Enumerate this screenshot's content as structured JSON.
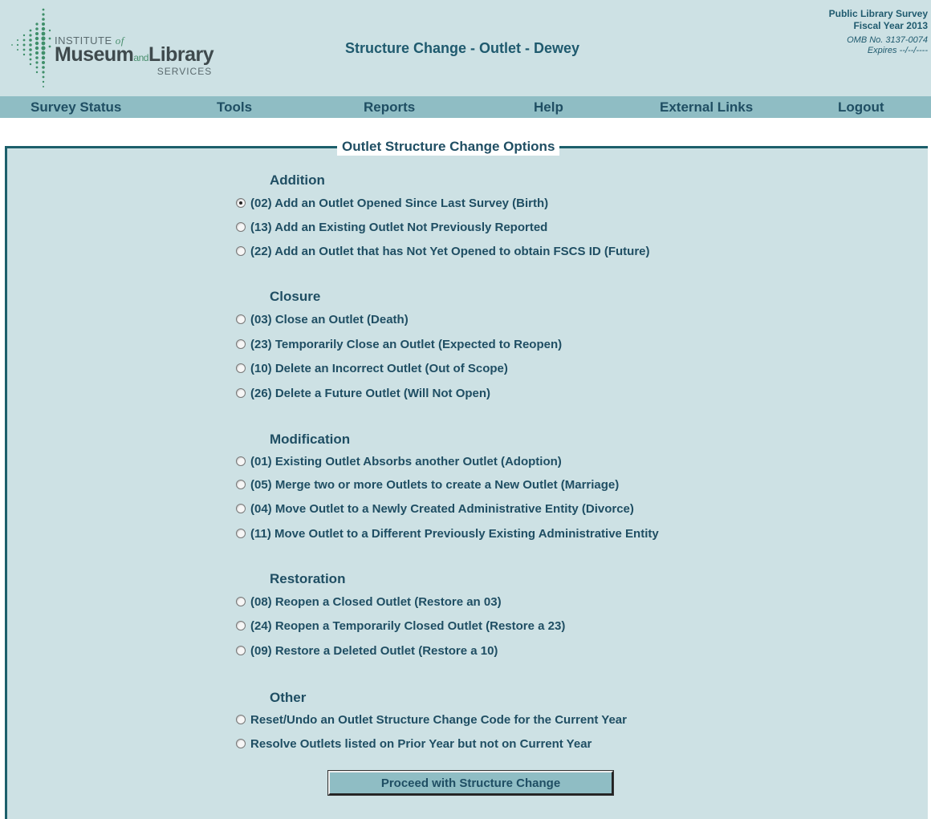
{
  "header": {
    "logo": {
      "institute": "INSTITUTE",
      "of": "of",
      "museum": "Museum",
      "and": "and",
      "library": "Library",
      "services": "SERVICES"
    },
    "page_title": "Structure Change - Outlet - Dewey",
    "survey_line1": "Public Library Survey",
    "survey_line2": "Fiscal Year 2013",
    "omb": "OMB No. 3137-0074",
    "expires": "Expires --/--/----"
  },
  "nav": {
    "items": [
      "Survey Status",
      "Tools",
      "Reports",
      "Help",
      "External Links",
      "Logout"
    ]
  },
  "panel": {
    "legend": "Outlet Structure Change Options",
    "groups": [
      {
        "heading": "Addition",
        "options": [
          {
            "label": "(02) Add an Outlet Opened Since Last Survey (Birth)",
            "checked": true
          },
          {
            "label": "(13) Add an Existing Outlet Not Previously Reported",
            "checked": false
          },
          {
            "label": "(22) Add an Outlet that has Not Yet Opened to obtain FSCS ID (Future)",
            "checked": false
          }
        ]
      },
      {
        "heading": "Closure",
        "options": [
          {
            "label": "(03) Close an Outlet (Death)",
            "checked": false
          },
          {
            "label": "(23) Temporarily Close an Outlet (Expected to Reopen)",
            "checked": false
          },
          {
            "label": "(10) Delete an Incorrect Outlet (Out of Scope)",
            "checked": false
          },
          {
            "label": "(26) Delete a Future Outlet (Will Not Open)",
            "checked": false
          }
        ]
      },
      {
        "heading": "Modification",
        "options": [
          {
            "label": "(01) Existing Outlet Absorbs another Outlet (Adoption)",
            "checked": false
          },
          {
            "label": "(05) Merge two or more Outlets to create a New Outlet (Marriage)",
            "checked": false
          },
          {
            "label": "(04) Move Outlet to a Newly Created Administrative Entity (Divorce)",
            "checked": false
          },
          {
            "label": "(11) Move Outlet to a Different Previously Existing Administrative Entity",
            "checked": false
          }
        ]
      },
      {
        "heading": "Restoration",
        "options": [
          {
            "label": "(08) Reopen a Closed Outlet (Restore an 03)",
            "checked": false
          },
          {
            "label": "(24) Reopen a Temporarily Closed Outlet (Restore a 23)",
            "checked": false
          },
          {
            "label": "(09) Restore a Deleted Outlet (Restore a 10)",
            "checked": false
          }
        ]
      },
      {
        "heading": "Other",
        "options": [
          {
            "label": "Reset/Undo an Outlet Structure Change Code for the Current Year",
            "checked": false
          },
          {
            "label": "Resolve Outlets listed on Prior Year but not on Current Year",
            "checked": false
          }
        ]
      }
    ],
    "proceed_label": "Proceed with Structure Change"
  }
}
